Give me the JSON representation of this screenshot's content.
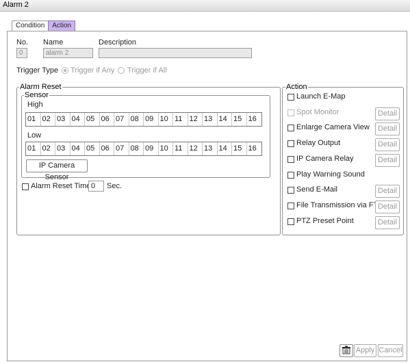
{
  "window": {
    "title": "Alarm 2"
  },
  "tabs": [
    {
      "label": "Condition",
      "active": false
    },
    {
      "label": "Action",
      "active": true
    }
  ],
  "info": {
    "no_label": "No.",
    "name_label": "Name",
    "description_label": "Description",
    "no_value": "0",
    "name_value": "alarm 2",
    "description_value": ""
  },
  "trigger": {
    "label": "Trigger Type",
    "options": [
      {
        "label": "Trigger if Any",
        "selected": true
      },
      {
        "label": "Trigger if All",
        "selected": false
      }
    ]
  },
  "alarm_reset": {
    "title": "Alarm Reset",
    "sensor": {
      "title": "Sensor",
      "high_label": "High",
      "low_label": "Low",
      "channels": [
        "01",
        "02",
        "03",
        "04",
        "05",
        "06",
        "07",
        "08",
        "09",
        "10",
        "11",
        "12",
        "13",
        "14",
        "15",
        "16"
      ],
      "ip_camera_button": "IP Camera Sensor"
    },
    "reset_time": {
      "label": "Alarm Reset Time",
      "value": "0",
      "unit": "Sec.",
      "checked": false
    }
  },
  "action": {
    "title": "Action",
    "items": [
      {
        "label": "Launch E-Map",
        "has_detail": false,
        "enabled": true
      },
      {
        "label": "Spot Monitor",
        "has_detail": true,
        "enabled": false
      },
      {
        "label": "Enlarge Camera View",
        "has_detail": true,
        "enabled": true
      },
      {
        "label": "Relay Output",
        "has_detail": true,
        "enabled": true
      },
      {
        "label": "IP Camera Relay",
        "has_detail": true,
        "enabled": true
      },
      {
        "label": "Play Warning Sound",
        "has_detail": false,
        "enabled": true
      },
      {
        "label": "Send E-Mail",
        "has_detail": true,
        "enabled": true
      },
      {
        "label": "File Transmission via FTP",
        "has_detail": true,
        "enabled": true
      },
      {
        "label": "PTZ Preset Point",
        "has_detail": true,
        "enabled": true
      }
    ],
    "detail_label": "Detail"
  },
  "footer": {
    "icon": "delete-icon",
    "apply_label": "Apply",
    "cancel_label": "Cancel"
  }
}
